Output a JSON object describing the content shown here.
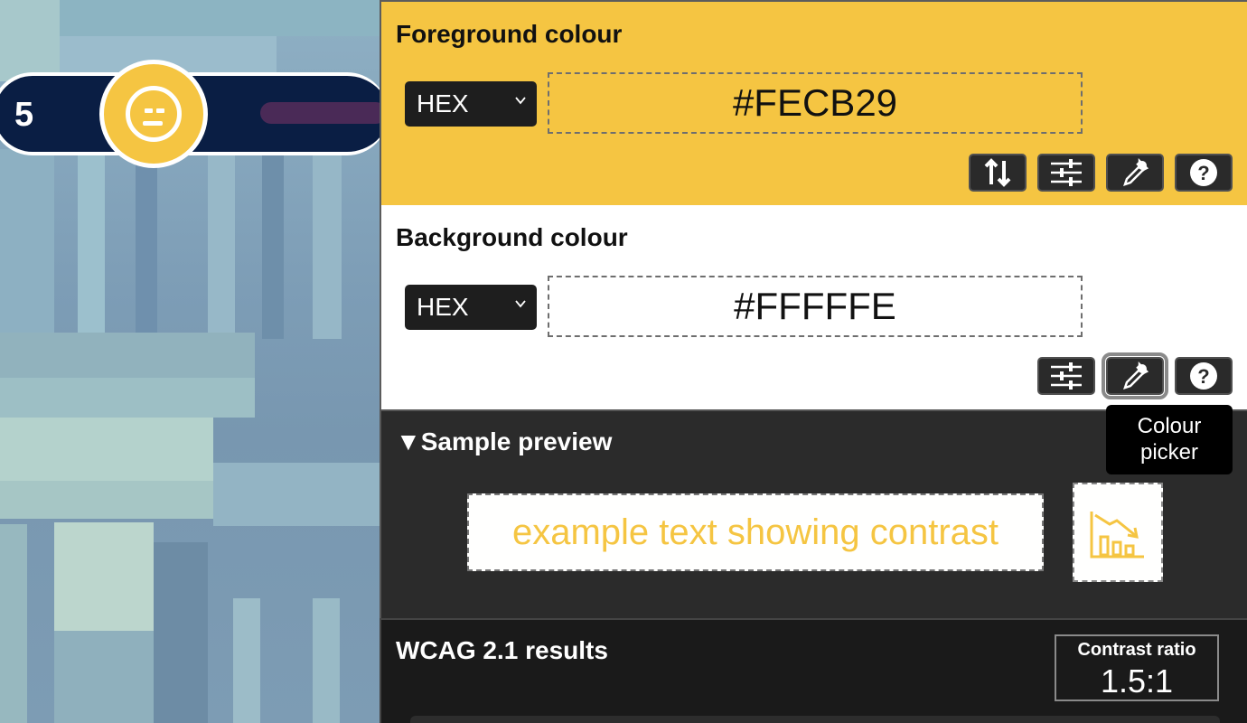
{
  "game": {
    "score": "5",
    "face_icon": "neutral-face-icon"
  },
  "foreground": {
    "title": "Foreground colour",
    "format": "HEX",
    "value": "#FECB29",
    "color": "#f5c542",
    "tools": [
      "swap-icon",
      "sliders-icon",
      "eyedropper-icon",
      "help-icon"
    ]
  },
  "background": {
    "title": "Background colour",
    "format": "HEX",
    "value": "#FFFFFE",
    "color": "#ffffff",
    "tools": [
      "sliders-icon",
      "eyedropper-icon",
      "help-icon"
    ]
  },
  "tooltip": {
    "text": "Colour picker"
  },
  "preview": {
    "title": "▼Sample preview",
    "sample_text": "example text showing contrast",
    "sample_icon": "chart-decline-icon"
  },
  "results": {
    "title": "WCAG 2.1 results",
    "ratio_label": "Contrast ratio",
    "ratio_value": "1.5:1"
  }
}
